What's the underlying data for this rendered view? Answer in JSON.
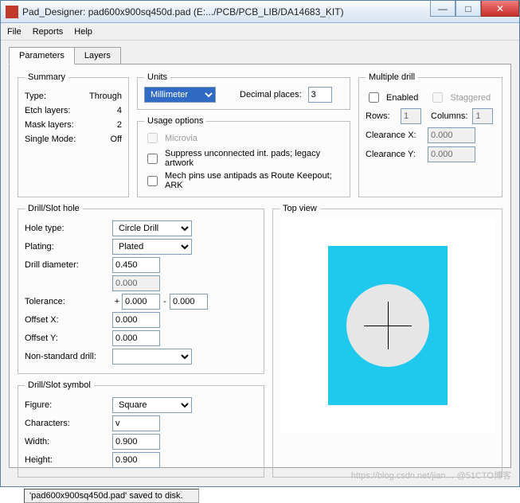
{
  "window": {
    "title": "Pad_Designer: pad600x900sq450d.pad (E:.../PCB/PCB_LIB/DA14683_KIT)"
  },
  "menu": {
    "file": "File",
    "reports": "Reports",
    "help": "Help"
  },
  "tabs": {
    "parameters": "Parameters",
    "layers": "Layers"
  },
  "summary": {
    "legend": "Summary",
    "type_label": "Type:",
    "type_val": "Through",
    "etch_label": "Etch layers:",
    "etch_val": "4",
    "mask_label": "Mask layers:",
    "mask_val": "2",
    "single_label": "Single Mode:",
    "single_val": "Off"
  },
  "units": {
    "legend": "Units",
    "select_val": "Millimeter",
    "dp_label": "Decimal places:",
    "dp_val": "3"
  },
  "usage": {
    "legend": "Usage options",
    "microvia": "Microvia",
    "suppress": "Suppress unconnected int. pads; legacy artwork",
    "mech": "Mech pins use antipads as Route Keepout; ARK"
  },
  "multdrill": {
    "legend": "Multiple drill",
    "enabled": "Enabled",
    "staggered": "Staggered",
    "rows_label": "Rows:",
    "rows_val": "1",
    "cols_label": "Columns:",
    "cols_val": "1",
    "cx_label": "Clearance X:",
    "cx_val": "0.000",
    "cy_label": "Clearance Y:",
    "cy_val": "0.000"
  },
  "drillhole": {
    "legend": "Drill/Slot hole",
    "holetype_label": "Hole type:",
    "holetype_val": "Circle Drill",
    "plating_label": "Plating:",
    "plating_val": "Plated",
    "dd_label": "Drill diameter:",
    "dd_val": "0.450",
    "dd2_val": "0.000",
    "tol_label": "Tolerance:",
    "tol_plus": "+",
    "tol_a": "0.000",
    "tol_dash": "-",
    "tol_b": "0.000",
    "ox_label": "Offset X:",
    "ox_val": "0.000",
    "oy_label": "Offset Y:",
    "oy_val": "0.000",
    "nsd_label": "Non-standard drill:",
    "nsd_val": ""
  },
  "symbol": {
    "legend": "Drill/Slot symbol",
    "figure_label": "Figure:",
    "figure_val": "Square",
    "chars_label": "Characters:",
    "chars_val": "v",
    "width_label": "Width:",
    "width_val": "0.900",
    "height_label": "Height:",
    "height_val": "0.900"
  },
  "topview": {
    "legend": "Top view"
  },
  "status": "'pad600x900sq450d.pad' saved to disk.",
  "watermark": "https://blog.csdn.net/jian…  @51CTO博客"
}
